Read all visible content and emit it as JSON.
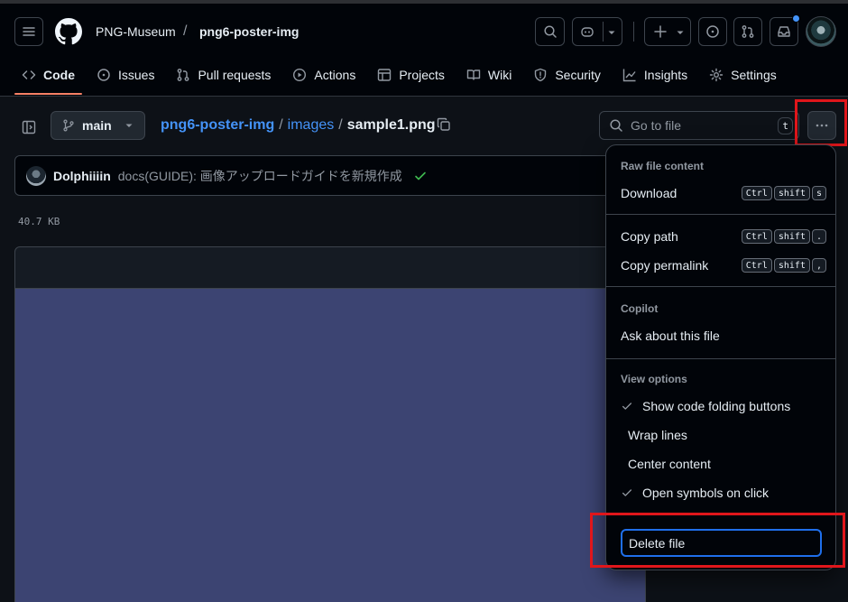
{
  "header": {
    "org": "PNG-Museum",
    "separator": "/",
    "repo": "png6-poster-img"
  },
  "tabs": [
    {
      "label": "Code",
      "icon": "code-icon",
      "active": true
    },
    {
      "label": "Issues",
      "icon": "issue-icon"
    },
    {
      "label": "Pull requests",
      "icon": "pull-request-icon"
    },
    {
      "label": "Actions",
      "icon": "play-icon"
    },
    {
      "label": "Projects",
      "icon": "table-icon"
    },
    {
      "label": "Wiki",
      "icon": "book-icon"
    },
    {
      "label": "Security",
      "icon": "shield-icon"
    },
    {
      "label": "Insights",
      "icon": "graph-icon"
    },
    {
      "label": "Settings",
      "icon": "gear-icon"
    }
  ],
  "file": {
    "branch": "main",
    "crumbs": [
      "png6-poster-img",
      "images",
      "sample1.png"
    ],
    "crumb_sep": "/",
    "size": "40.7 KB",
    "goto_placeholder": "Go to file",
    "goto_key": "t"
  },
  "commit": {
    "author": "Dolphiiiin",
    "message": "docs(GUIDE): 画像アップロードガイドを新規作成"
  },
  "menu": {
    "raw_title": "Raw file content",
    "download": {
      "label": "Download",
      "keys": [
        "Ctrl",
        "shift",
        "s"
      ]
    },
    "copy_path": {
      "label": "Copy path",
      "keys": [
        "Ctrl",
        "shift",
        "."
      ]
    },
    "copy_permalink": {
      "label": "Copy permalink",
      "keys": [
        "Ctrl",
        "shift",
        ","
      ]
    },
    "copilot_title": "Copilot",
    "ask": "Ask about this file",
    "view_title": "View options",
    "show_folding": "Show code folding buttons",
    "wrap_lines": "Wrap lines",
    "center_content": "Center content",
    "open_symbols": "Open symbols on click",
    "delete": "Delete file"
  },
  "colors": {
    "accent_link": "#4493f8",
    "active_tab": "#f78166",
    "highlight": "#e0161b",
    "success": "#3fb950",
    "image_fill": "#3c4472"
  }
}
